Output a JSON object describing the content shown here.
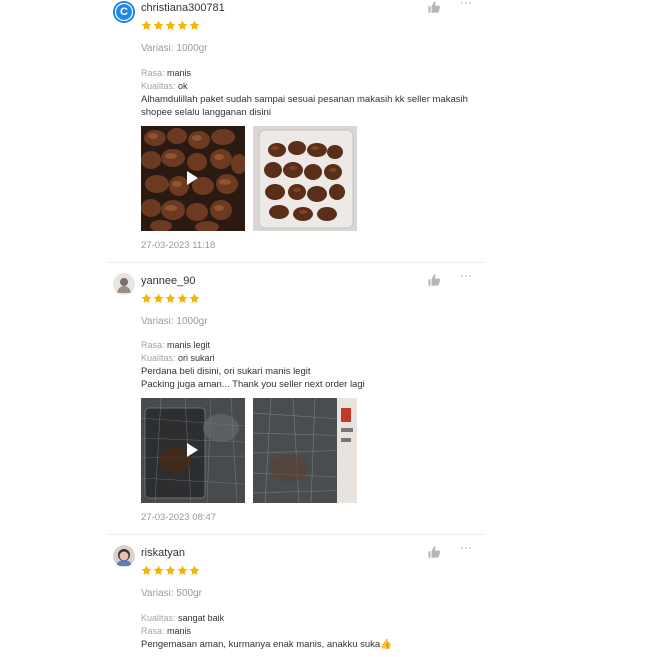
{
  "reviews": [
    {
      "username": "christiana300781",
      "avatar_letter": "C",
      "avatar_color": "#1e88e5",
      "rating": 5,
      "variation": "Variasi: 1000gr",
      "attributes": [
        {
          "key": "Rasa:",
          "value": "manis"
        },
        {
          "key": "Kualitas:",
          "value": "ok"
        }
      ],
      "text_lines": [
        "Alhamdulillah paket sudah sampai sesuai pesanan makasih kk seller makasih",
        "shopee selalu langganan disini"
      ],
      "media": [
        {
          "type": "video",
          "icon": "play-icon"
        },
        {
          "type": "photo"
        }
      ],
      "date": "27-03-2023 11:18"
    },
    {
      "username": "yannee_90",
      "rating": 5,
      "variation": "Variasi: 1000gr",
      "attributes": [
        {
          "key": "Rasa:",
          "value": "manis legit"
        },
        {
          "key": "Kualitas:",
          "value": "ori sukari"
        }
      ],
      "text_lines": [
        "Perdana beli disini, ori sukari manis legit",
        "Packing juga aman... Thank you seller next order lagi"
      ],
      "media": [
        {
          "type": "video",
          "icon": "play-icon"
        },
        {
          "type": "photo"
        }
      ],
      "date": "27-03-2023 08:47"
    },
    {
      "username": "riskatyan",
      "rating": 5,
      "variation": "Variasi: 500gr",
      "attributes": [
        {
          "key": "Kualitas:",
          "value": "sangat baik"
        },
        {
          "key": "Rasa:",
          "value": "manis"
        }
      ],
      "text_lines": [
        "Pengemasan aman, kurmanya enak manis, anakku suka👍"
      ]
    }
  ],
  "colors": {
    "star": "#f5b400",
    "muted_text": "#9a9a9a",
    "icon_gray": "#b5b5b5"
  },
  "icons": {
    "like": "thumbs-up-icon",
    "more": "more-options-icon",
    "rating": "star-icon"
  },
  "more_label": "···"
}
